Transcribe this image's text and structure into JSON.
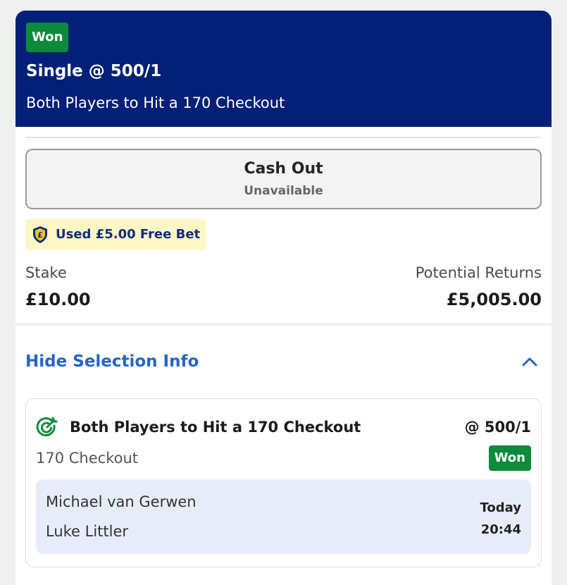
{
  "bet": {
    "status_badge": "Won",
    "title": "Single @ 500/1",
    "market": "Both Players to Hit a 170 Checkout"
  },
  "cash_out": {
    "label": "Cash Out",
    "status": "Unavailable"
  },
  "free_bet": {
    "text": "Used £5.00 Free Bet",
    "icon": "pound-shield-icon"
  },
  "stake": {
    "label": "Stake",
    "value": "£10.00"
  },
  "returns": {
    "label": "Potential Returns",
    "value": "£5,005.00"
  },
  "selection_toggle": {
    "label": "Hide Selection Info",
    "icon": "chevron-up-icon"
  },
  "selection": {
    "icon": "dart-target-icon",
    "name": "Both Players to Hit a 170 Checkout",
    "odds": "@ 500/1",
    "market": "170 Checkout",
    "result": "Won",
    "players": [
      "Michael van Gerwen",
      "Luke Littler"
    ],
    "day": "Today",
    "time": "20:44"
  },
  "colors": {
    "header_bg": "#022078",
    "won_green": "#0d8a3a",
    "link_blue": "#2764c4",
    "free_bet_bg": "#fff6c6"
  }
}
